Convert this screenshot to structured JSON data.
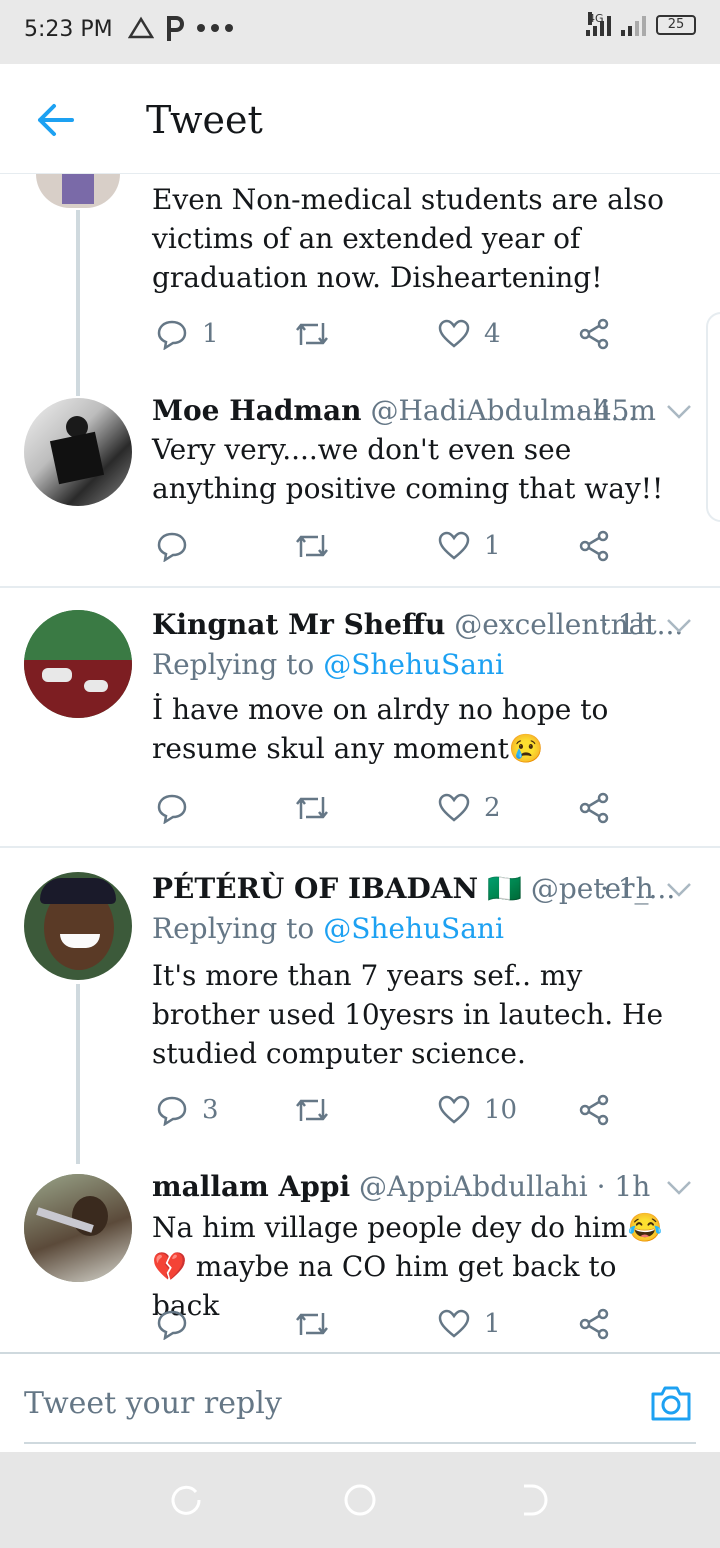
{
  "status_bar": {
    "time": "5:23 PM",
    "network": "4G",
    "battery": "25"
  },
  "header": {
    "title": "Tweet"
  },
  "tweets": [
    {
      "body": "Even Non-medical students are also victims of an extended year of graduation now. Disheartening!",
      "replies": "1",
      "retweets": "",
      "likes": "4"
    },
    {
      "name": "Moe Hadman",
      "handle": "@HadiAbdulmali...",
      "time": "· 45m",
      "body": "Very very....we don't even see anything positive coming that way!!",
      "replies": "",
      "retweets": "",
      "likes": "1"
    },
    {
      "name": "Kingnat Mr Sheffu",
      "handle": "@excellentnat...",
      "time": "· 1h",
      "replying_prefix": "Replying to",
      "replying_to": "@ShehuSani",
      "body": "İ have move on alrdy no hope to resume skul any moment😢",
      "replies": "",
      "retweets": "",
      "likes": "2"
    },
    {
      "name": "PÉTÉRÙ OF IBADAN",
      "flag": "🇳🇬",
      "handle": "@peter_...",
      "time": "· 1h",
      "replying_prefix": "Replying to",
      "replying_to": "@ShehuSani",
      "body": "It's more than 7 years sef.. my brother used 10yesrs in lautech. He studied computer science.",
      "replies": "3",
      "retweets": "",
      "likes": "10"
    },
    {
      "name": "mallam Appi",
      "handle": "@AppiAbdullahi",
      "time": "· 1h",
      "body": "Na him village people dey do him😂💔 maybe na CO him get back to back",
      "replies": "",
      "retweets": "",
      "likes": "1"
    }
  ],
  "reply_bar": {
    "placeholder": "Tweet your reply"
  },
  "colors": {
    "accent": "#1da1f2",
    "secondary_text": "#657786",
    "primary_text": "#14171a"
  }
}
